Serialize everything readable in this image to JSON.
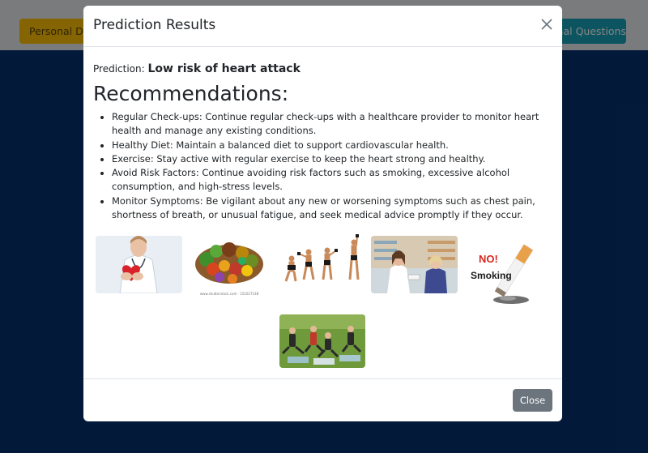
{
  "background": {
    "tabs": [
      {
        "label": "Personal Data"
      },
      {
        "label": "Additional Questions"
      }
    ]
  },
  "modal": {
    "title": "Prediction Results",
    "prediction_label": "Prediction:",
    "prediction_value": "Low risk of heart attack",
    "recommendations_heading": "Recommendations:",
    "recommendations": [
      "Regular Check-ups: Continue regular check-ups with a healthcare provider to monitor heart health and manage any existing conditions.",
      "Healthy Diet: Maintain a balanced diet to support cardiovascular health.",
      "Exercise: Stay active with regular exercise to keep the heart strong and healthy.",
      "Avoid Risk Factors: Continue avoiding risk factors such as smoking, excessive alcohol consumption, and high-stress levels.",
      "Monitor Symptoms: Be vigilant about any new or worsening symptoms such as chest pain, shortness of breath, or unusual fatigue, and seek medical advice promptly if they occur."
    ],
    "images": [
      {
        "name": "doctor-heart-image"
      },
      {
        "name": "healthy-food-image",
        "caption": "www.shutterstock.com · 151027238"
      },
      {
        "name": "exercise-figures-image"
      },
      {
        "name": "pharmacist-consultation-image"
      },
      {
        "name": "no-smoking-image",
        "text_no": "NO!",
        "text_smoking": "Smoking"
      },
      {
        "name": "group-yoga-image"
      }
    ],
    "close_button_label": "Close"
  }
}
